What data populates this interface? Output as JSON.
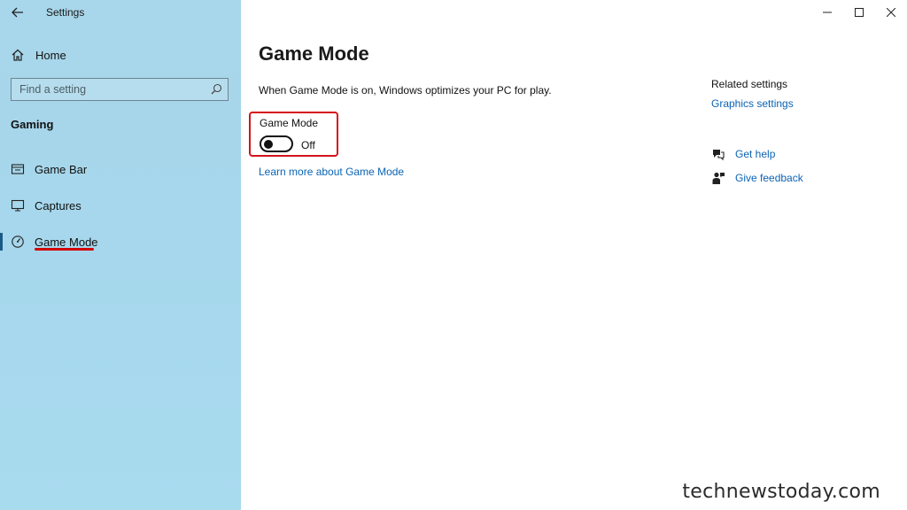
{
  "window": {
    "title": "Settings"
  },
  "sidebar": {
    "home_label": "Home",
    "search": {
      "placeholder": "Find a setting"
    },
    "section_title": "Gaming",
    "items": [
      {
        "label": "Game Bar",
        "icon": "game-bar-icon",
        "selected": false
      },
      {
        "label": "Captures",
        "icon": "captures-icon",
        "selected": false
      },
      {
        "label": "Game Mode",
        "icon": "game-mode-icon",
        "selected": true
      }
    ]
  },
  "main": {
    "title": "Game Mode",
    "description": "When Game Mode is on, Windows optimizes your PC for play.",
    "toggle": {
      "label": "Game Mode",
      "state": "Off",
      "on": false
    },
    "learn_more": "Learn more about Game Mode",
    "related": {
      "title": "Related settings",
      "link": "Graphics settings"
    },
    "help": {
      "get_help": "Get help",
      "feedback": "Give feedback"
    }
  },
  "watermark": "technewstoday.com",
  "colors": {
    "sidebar_bg": "#a8d6ea",
    "accent_link": "#0b63b4",
    "highlight": "#d4131b"
  }
}
